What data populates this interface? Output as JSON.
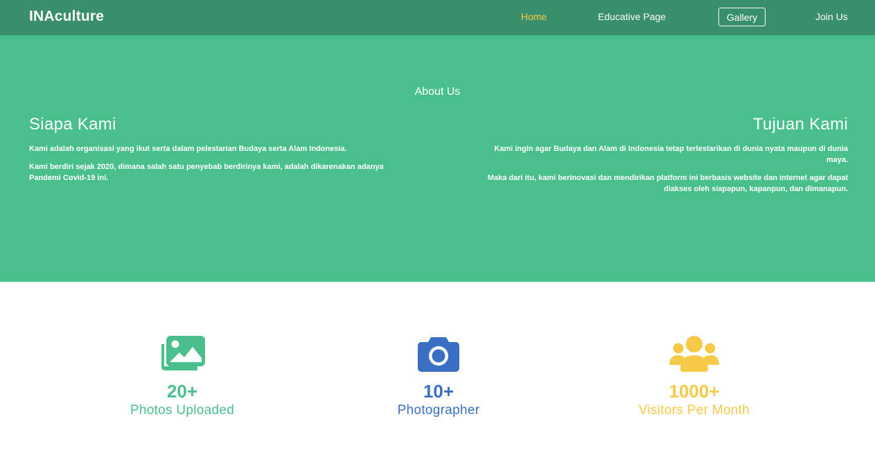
{
  "navbar": {
    "brand": "INAculture",
    "links": [
      "Home",
      "Educative Page",
      "Gallery",
      "Join Us"
    ]
  },
  "about": {
    "title": "About Us",
    "left": {
      "heading": "Siapa Kami",
      "paragraphs": [
        "Kami adalah organisasi yang ikut serta dalam pelestarian Budaya serta Alam Indonesia.",
        "Kami berdiri sejak 2020, dimana salah satu penyebab berdirinya kami, adalah dikarenakan adanya Pandemi Covid-19 ini."
      ]
    },
    "right": {
      "heading": "Tujuan Kami",
      "paragraphs": [
        "Kami ingin agar Budaya dan Alam di Indonesia tetap terlestarikan di dunia nyata maupun di dunia maya.",
        "Maka dari itu, kami berinovasi dan mendirikan platform ini berbasis website dan internet agar dapat diakses oleh siapapun, kapanpun, dan dimanapun."
      ]
    }
  },
  "stats": [
    {
      "number": "20+",
      "label": "Photos Uploaded",
      "icon": "images-icon",
      "color": "#49bf8c"
    },
    {
      "number": "10+",
      "label": "Photographer",
      "icon": "camera-icon",
      "color": "#3a6fc4"
    },
    {
      "number": "1000+",
      "label": "Visitors Per Month",
      "icon": "users-icon",
      "color": "#f7c948"
    }
  ],
  "colors": {
    "navbar_bg": "#3a8f6b",
    "about_bg": "#49bf8c",
    "active_link": "#f7c948"
  }
}
